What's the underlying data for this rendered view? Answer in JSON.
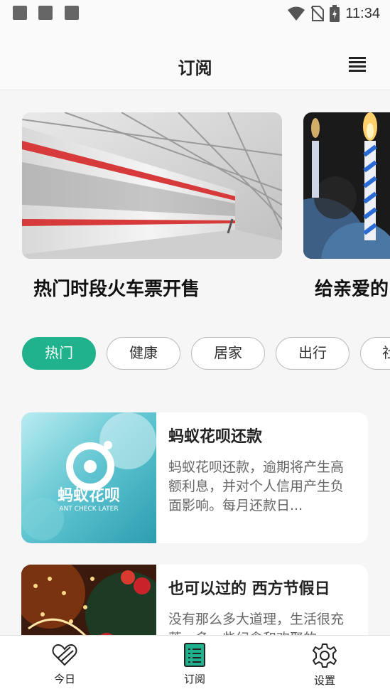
{
  "status_bar": {
    "time": "11:34"
  },
  "header": {
    "title": "订阅"
  },
  "banner": [
    {
      "caption": "热门时段火车票开售"
    },
    {
      "caption": "给亲爱的"
    }
  ],
  "chips": [
    {
      "label": "热门",
      "active": true
    },
    {
      "label": "健康"
    },
    {
      "label": "居家"
    },
    {
      "label": "出行"
    },
    {
      "label": "社"
    }
  ],
  "articles": [
    {
      "title": "蚂蚁花呗还款",
      "desc": "蚂蚁花呗还款，逾期将产生高额利息，并对个人信用产生负面影响。每月还款日...",
      "logo_text": "蚂蚁花呗",
      "logo_sub": "ANT CHECK LATER"
    },
    {
      "title": "也可以过的 西方节假日",
      "desc": "没有那么多大道理，生活很充落，多一些纪念和欢聚的"
    }
  ],
  "tabbar": [
    {
      "label": "今日",
      "icon": "heart-icon"
    },
    {
      "label": "订阅",
      "icon": "list-icon",
      "active": true,
      "color": "#1fb28c"
    },
    {
      "label": "设置",
      "icon": "gear-icon"
    }
  ]
}
